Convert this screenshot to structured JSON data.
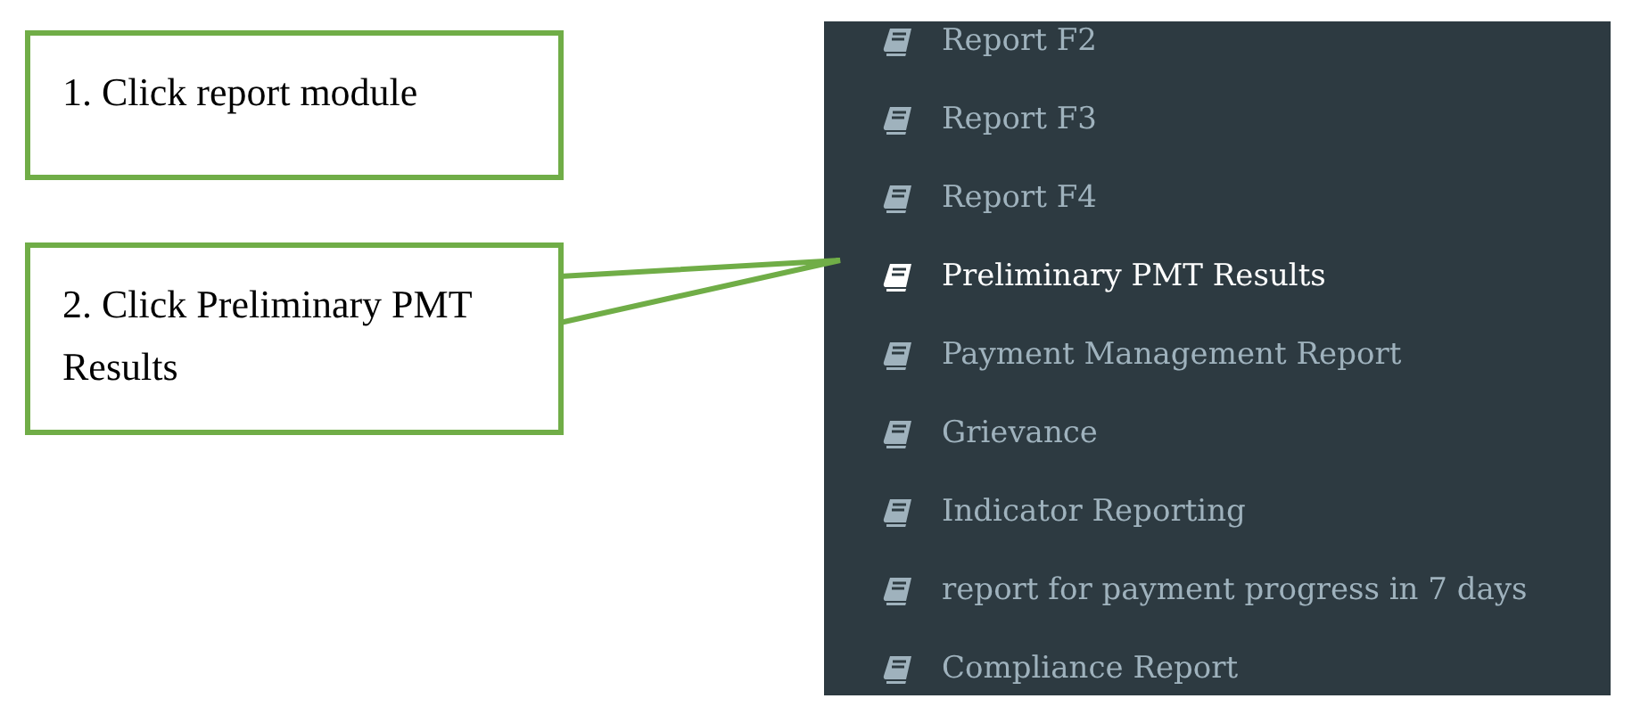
{
  "callouts": [
    {
      "text": "1. Click report module",
      "pointer": false
    },
    {
      "text": "2. Click Preliminary PMT Results",
      "pointer": true
    }
  ],
  "sidebar": {
    "items": [
      {
        "label": "Report F2",
        "selected": false
      },
      {
        "label": "Report F3",
        "selected": false
      },
      {
        "label": "Report F4",
        "selected": false
      },
      {
        "label": "Preliminary PMT Results",
        "selected": true
      },
      {
        "label": "Payment Management Report",
        "selected": false
      },
      {
        "label": "Grievance",
        "selected": false
      },
      {
        "label": "Indicator Reporting",
        "selected": false
      },
      {
        "label": "report for payment progress in 7 days",
        "selected": false
      },
      {
        "label": "Compliance Report",
        "selected": false
      }
    ]
  }
}
